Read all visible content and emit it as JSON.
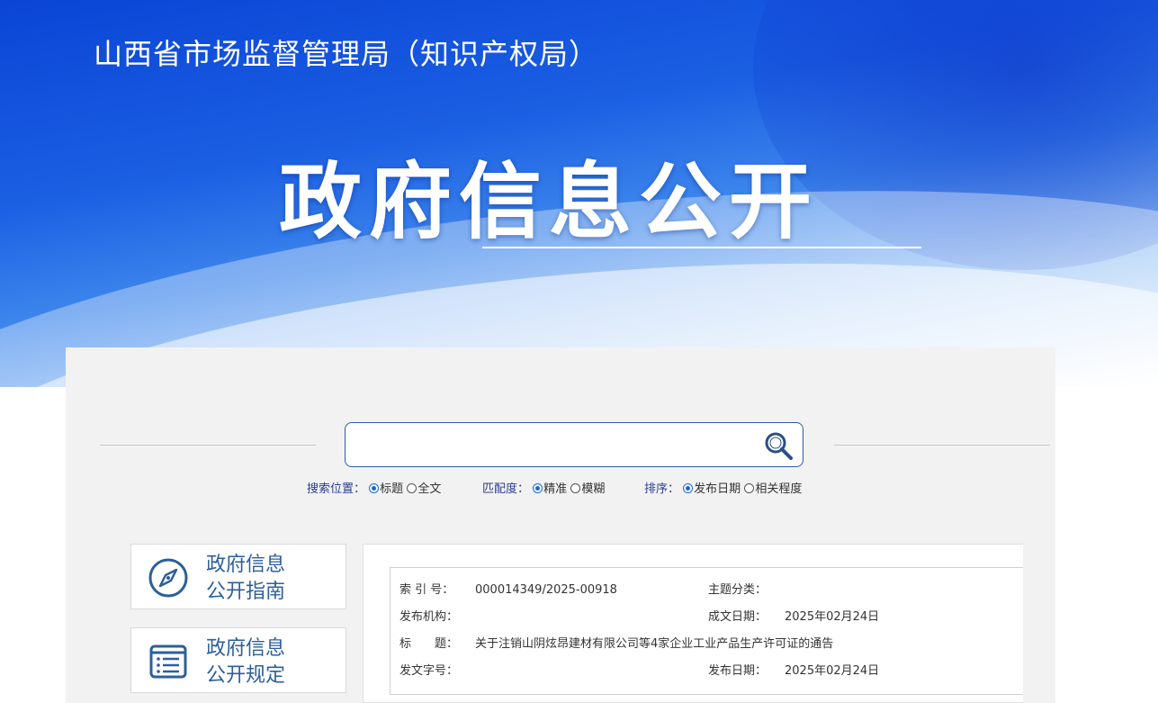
{
  "header": {
    "site_title": "山西省市场监督管理局（知识产权局）",
    "hero_title": "政府信息公开"
  },
  "search": {
    "placeholder": "",
    "position": {
      "label": "搜索位置：",
      "options": [
        "标题",
        "全文"
      ],
      "selected": "标题"
    },
    "match": {
      "label": "匹配度：",
      "options": [
        "精准",
        "模糊"
      ],
      "selected": "精准"
    },
    "sort": {
      "label": "排序：",
      "options": [
        "发布日期",
        "相关程度"
      ],
      "selected": "发布日期"
    }
  },
  "sidebar": {
    "items": [
      {
        "line1": "政府信息",
        "line2": "公开指南",
        "icon": "compass-icon"
      },
      {
        "line1": "政府信息",
        "line2": "公开规定",
        "icon": "document-list-icon"
      }
    ]
  },
  "meta": {
    "index_label": "索 引 号：",
    "index_value": "000014349/2025-00918",
    "topic_label": "主题分类：",
    "topic_value": "",
    "publisher_label": "发布机构：",
    "publisher_value": "",
    "written_date_label": "成文日期：",
    "written_date_value": "2025年02月24日",
    "title_label": "标　　题：",
    "title_value": "关于注销山阴炫昂建材有限公司等4家企业工业产品生产许可证的通告",
    "doc_no_label": "发文字号：",
    "doc_no_value": "",
    "publish_date_label": "发布日期：",
    "publish_date_value": "2025年02月24日"
  },
  "colors": {
    "hero_blue": "#1b5fe3",
    "link_blue": "#2d5f9a",
    "radio_blue": "#1a66d2"
  }
}
